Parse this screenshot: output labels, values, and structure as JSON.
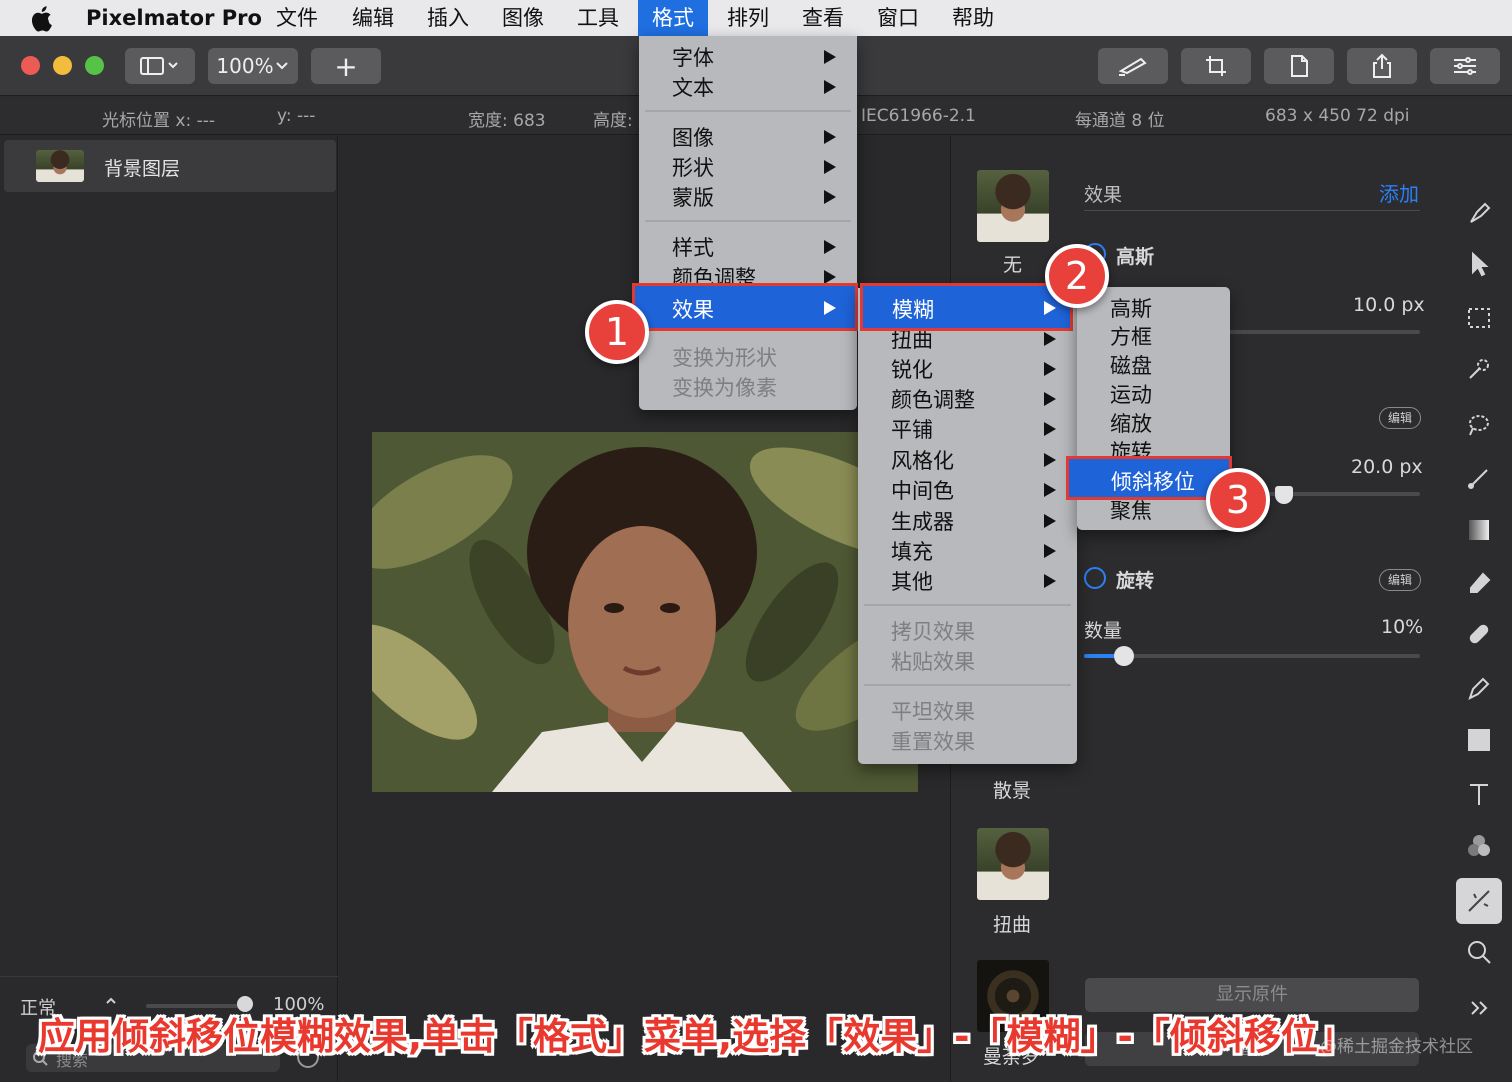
{
  "menubar": {
    "app_name": "Pixelmator Pro",
    "items": [
      "文件",
      "编辑",
      "插入",
      "图像",
      "工具",
      "格式",
      "排列",
      "查看",
      "窗口",
      "帮助"
    ],
    "active": "格式"
  },
  "toolbar": {
    "zoom": "100%",
    "add": "+"
  },
  "infobar": {
    "cursor_x": "光标位置 x:  ---",
    "cursor_y": "y:  ---",
    "width": "宽度:  683",
    "height": "高度:",
    "profile": "IEC61966-2.1",
    "depth": "每通道 8 位",
    "size": "683 x 450 72 dpi"
  },
  "layers": {
    "layer_name": "背景图层",
    "blend_mode": "正常",
    "opacity": "100%",
    "search_placeholder": "搜索"
  },
  "effects_panel": {
    "title": "效果",
    "add": "添加",
    "thumb_none": "无",
    "thumb_bokeh": "散景",
    "thumb_distort": "扭曲",
    "thumb_bottom": "曼荼罗",
    "gaussian": "高斯",
    "gaussian_value": "10.0 px",
    "edit": "编辑",
    "value2": "20.0 px",
    "rotate": "旋转",
    "amount": "数量",
    "amount_value": "10%",
    "amount_fraction": 0.12,
    "show_original": "显示原件",
    "reset": "重置"
  },
  "menu_format": {
    "items": [
      "字体",
      "文本",
      "图像",
      "形状",
      "蒙版",
      "样式",
      "颜色调整",
      "效果",
      "变换为形状",
      "变换为像素"
    ]
  },
  "menu_effects": {
    "items": [
      "模糊",
      "扭曲",
      "锐化",
      "颜色调整",
      "平铺",
      "风格化",
      "中间色",
      "生成器",
      "填充",
      "其他",
      "拷贝效果",
      "粘贴效果",
      "平坦效果",
      "重置效果"
    ]
  },
  "menu_blur": {
    "items": [
      "高斯",
      "方框",
      "磁盘",
      "运动",
      "缩放",
      "旋转",
      "倾斜移位",
      "聚焦"
    ]
  },
  "callouts": [
    "1",
    "2",
    "3"
  ],
  "caption": "应用倾斜移位模糊效果,单击「格式」菜单,选择「效果」-「模糊」-「倾斜移位」",
  "watermark": "@稀土掘金技术社区",
  "colors": {
    "accent": "#1f63d8",
    "callout": "#e8403a",
    "menubar": "#e9e8ea"
  }
}
